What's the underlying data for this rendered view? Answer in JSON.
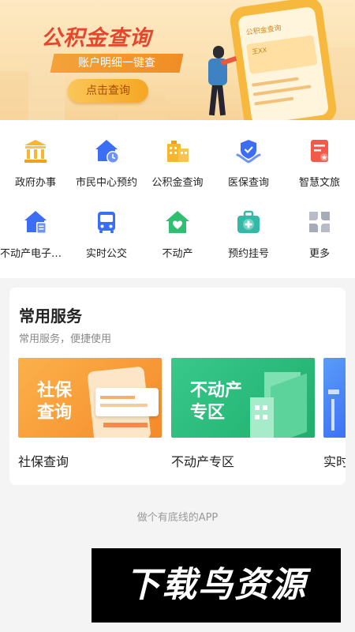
{
  "banner": {
    "title": "公积金查询",
    "subtitle": "账户明细一键查",
    "button_label": "点击查询",
    "phone_title": "公积金查询",
    "phone_card_name": "王XX"
  },
  "grid": [
    {
      "label": "政府办事",
      "icon": "government-building-icon",
      "color": "#f6b630"
    },
    {
      "label": "市民中心预约",
      "icon": "home-clock-icon",
      "color": "#3b6ef5"
    },
    {
      "label": "公积金查询",
      "icon": "fund-building-icon",
      "color": "#f6b630"
    },
    {
      "label": "医保查询",
      "icon": "shield-hands-icon",
      "color": "#3b6ef5"
    },
    {
      "label": "智慧文旅",
      "icon": "document-red-icon",
      "color": "#f25a4a"
    },
    {
      "label": "不动产电子证照",
      "icon": "home-document-icon",
      "color": "#3b6ef5"
    },
    {
      "label": "实时公交",
      "icon": "bus-icon",
      "color": "#3b6ef5"
    },
    {
      "label": "不动产",
      "icon": "house-heart-icon",
      "color": "#2fbf71"
    },
    {
      "label": "预约挂号",
      "icon": "medical-kit-icon",
      "color": "#33b9a6"
    },
    {
      "label": "更多",
      "icon": "more-grid-icon",
      "color": "#b8bcc8"
    }
  ],
  "services": {
    "title": "常用服务",
    "subtitle": "常用服务，便捷使用",
    "items": [
      {
        "label": "社保查询",
        "image_text": "社保\n查询"
      },
      {
        "label": "不动产专区",
        "image_text": "不动产\n专区"
      },
      {
        "label": "实时公交"
      }
    ]
  },
  "footer_note": "做个有底线的APP",
  "watermark": "下载鸟资源"
}
